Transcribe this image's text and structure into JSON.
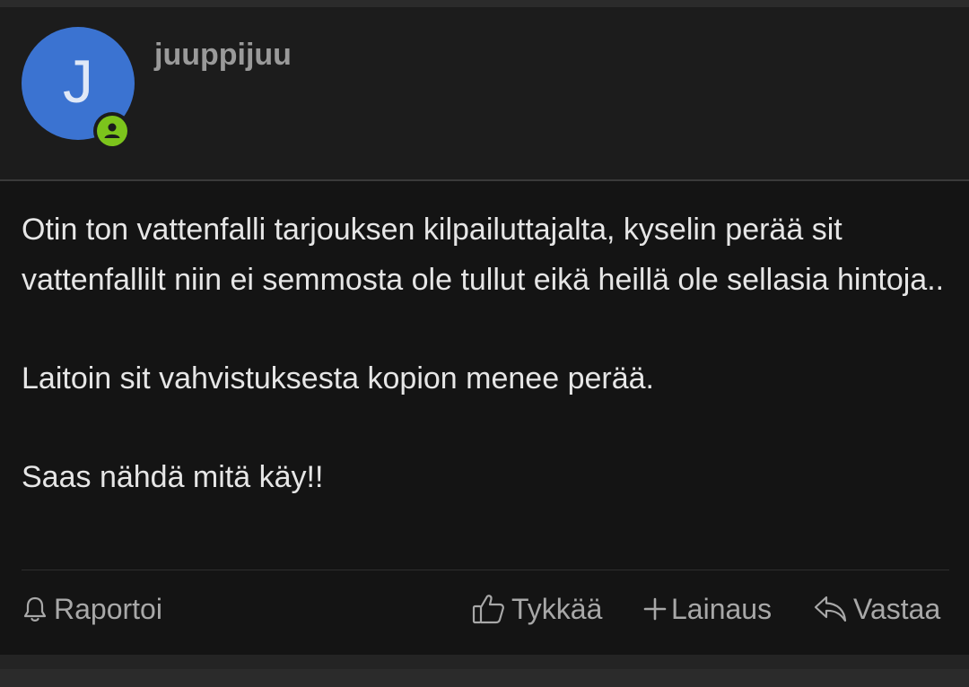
{
  "post": {
    "avatar_letter": "J",
    "username": "juuppijuu",
    "paragraphs": [
      "Otin ton vattenfalli tarjouksen kilpailuttajalta, kyselin perää sit vattenfallilt niin ei semmosta ole tullut eikä heillä ole sellasia hintoja..",
      "Laitoin sit vahvistuksesta kopion menee perää.",
      "Saas nähdä mitä käy!!"
    ]
  },
  "actions": {
    "report_label": "Raportoi",
    "like_label": "Tykkää",
    "quote_label": "Lainaus",
    "reply_label": "Vastaa"
  },
  "colors": {
    "avatar": "#3b73d1",
    "online_status": "#7cc41c",
    "background": "#141414"
  },
  "icons": {
    "report": "bell-icon",
    "like": "thumbs-up-icon",
    "quote": "plus-icon",
    "reply": "reply-arrow-icon",
    "status": "user-online-icon"
  }
}
